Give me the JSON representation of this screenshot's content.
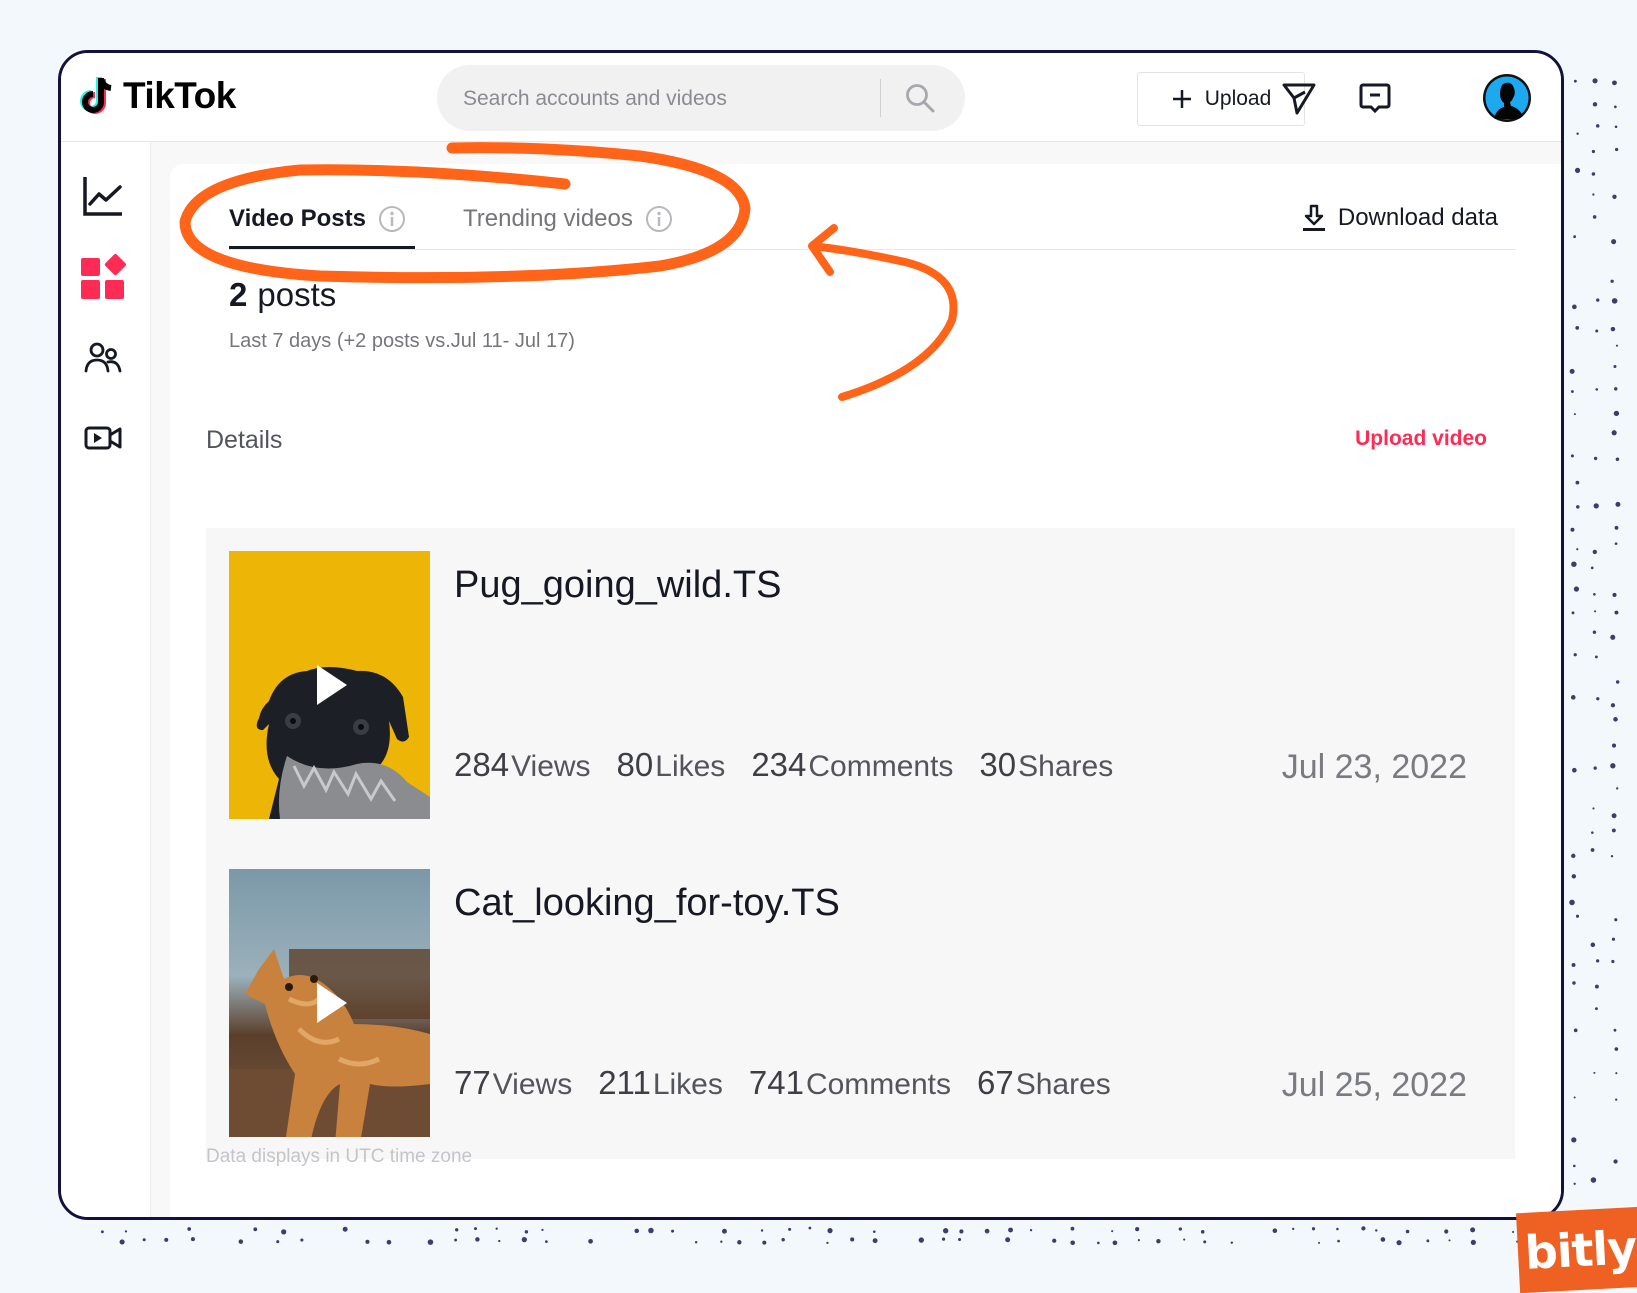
{
  "app": {
    "name": "TikTok"
  },
  "header": {
    "search_placeholder": "Search accounts and videos",
    "search_value": "",
    "upload_label": "Upload",
    "icons": [
      "search-icon",
      "plus-icon",
      "send-icon",
      "message-icon",
      "avatar"
    ]
  },
  "sidebar": {
    "items": [
      {
        "name": "analytics",
        "icon": "line-chart-icon"
      },
      {
        "name": "content",
        "icon": "grid-shapes-icon",
        "active": true
      },
      {
        "name": "followers",
        "icon": "users-icon"
      },
      {
        "name": "live",
        "icon": "video-camera-icon"
      }
    ]
  },
  "tabs": [
    {
      "label": "Video Posts",
      "active": true,
      "icon": "info-icon"
    },
    {
      "label": "Trending videos",
      "active": false,
      "icon": "info-icon"
    }
  ],
  "download_label": "Download data",
  "summary": {
    "count": "2",
    "count_label": "posts",
    "subtitle": "Last 7 days (+2 posts vs.Jul 11- Jul 17)"
  },
  "details": {
    "label": "Details",
    "upload_video_label": "Upload video",
    "videos": [
      {
        "title": "Pug_going_wild.TS",
        "thumbnail": "pug on yellow background",
        "views": "284",
        "views_label": "Views",
        "likes": "80",
        "likes_label": "Likes",
        "comments": "234",
        "comments_label": "Comments",
        "shares": "30",
        "shares_label": "Shares",
        "date": "Jul 23, 2022"
      },
      {
        "title": "Cat_looking_for-toy.TS",
        "thumbnail": "orange cat on wooden table",
        "views": "77",
        "views_label": "Views",
        "likes": "211",
        "likes_label": "Likes",
        "comments": "741",
        "comments_label": "Comments",
        "shares": "67",
        "shares_label": "Shares",
        "date": "Jul 25, 2022"
      }
    ]
  },
  "footer_note": "Data displays in UTC time zone",
  "branding": {
    "badge": "bitly"
  },
  "colors": {
    "accent": "#fe2c55",
    "annotation": "#ff6418",
    "frame": "#14123d",
    "bitly": "#ee6123",
    "avatar_bg": "#1da9f0"
  }
}
